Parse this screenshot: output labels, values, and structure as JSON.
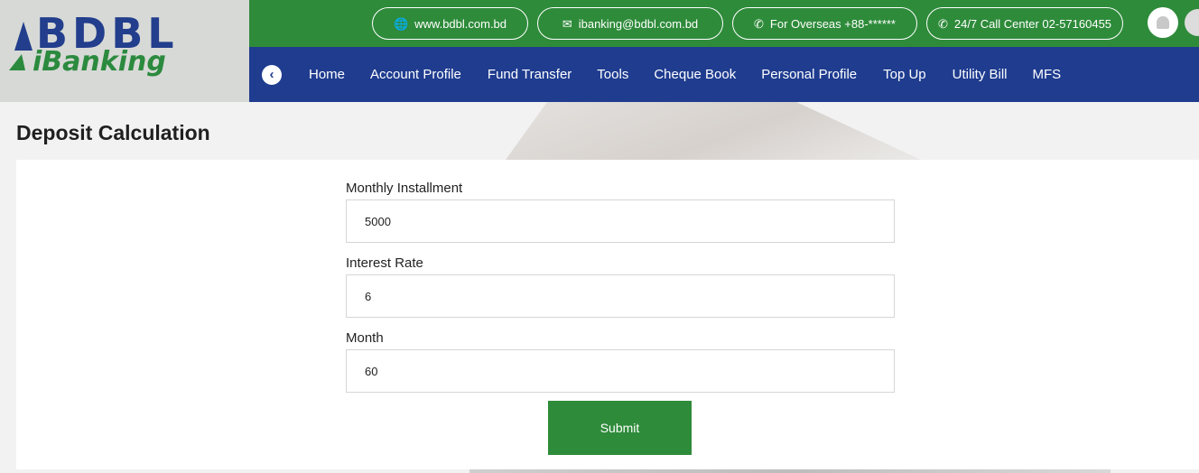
{
  "logo": {
    "line1": "BDBL",
    "line2": "iBanking"
  },
  "topbar": {
    "website": "www.bdbl.com.bd",
    "email": "ibanking@bdbl.com.bd",
    "overseas": "For Overseas +88-******",
    "call_center": "24/7 Call Center 02-57160455"
  },
  "nav": {
    "items": [
      "Home",
      "Account Profile",
      "Fund Transfer",
      "Tools",
      "Cheque Book",
      "Personal Profile",
      "Top Up",
      "Utility Bill",
      "MFS"
    ]
  },
  "page": {
    "title": "Deposit Calculation"
  },
  "form": {
    "monthly_installment": {
      "label": "Monthly Installment",
      "value": "5000"
    },
    "interest_rate": {
      "label": "Interest Rate",
      "value": "6"
    },
    "month": {
      "label": "Month",
      "value": "60"
    },
    "submit_label": "Submit"
  },
  "colors": {
    "green": "#2e8b3a",
    "navy": "#1f3c8f",
    "logo_bg": "#d7d9d6"
  },
  "icons": {
    "website": "globe-icon",
    "email": "envelope-icon",
    "overseas": "phone-icon",
    "call_center": "phone-icon",
    "notifications": "bell-icon",
    "back": "chevron-left-icon"
  }
}
